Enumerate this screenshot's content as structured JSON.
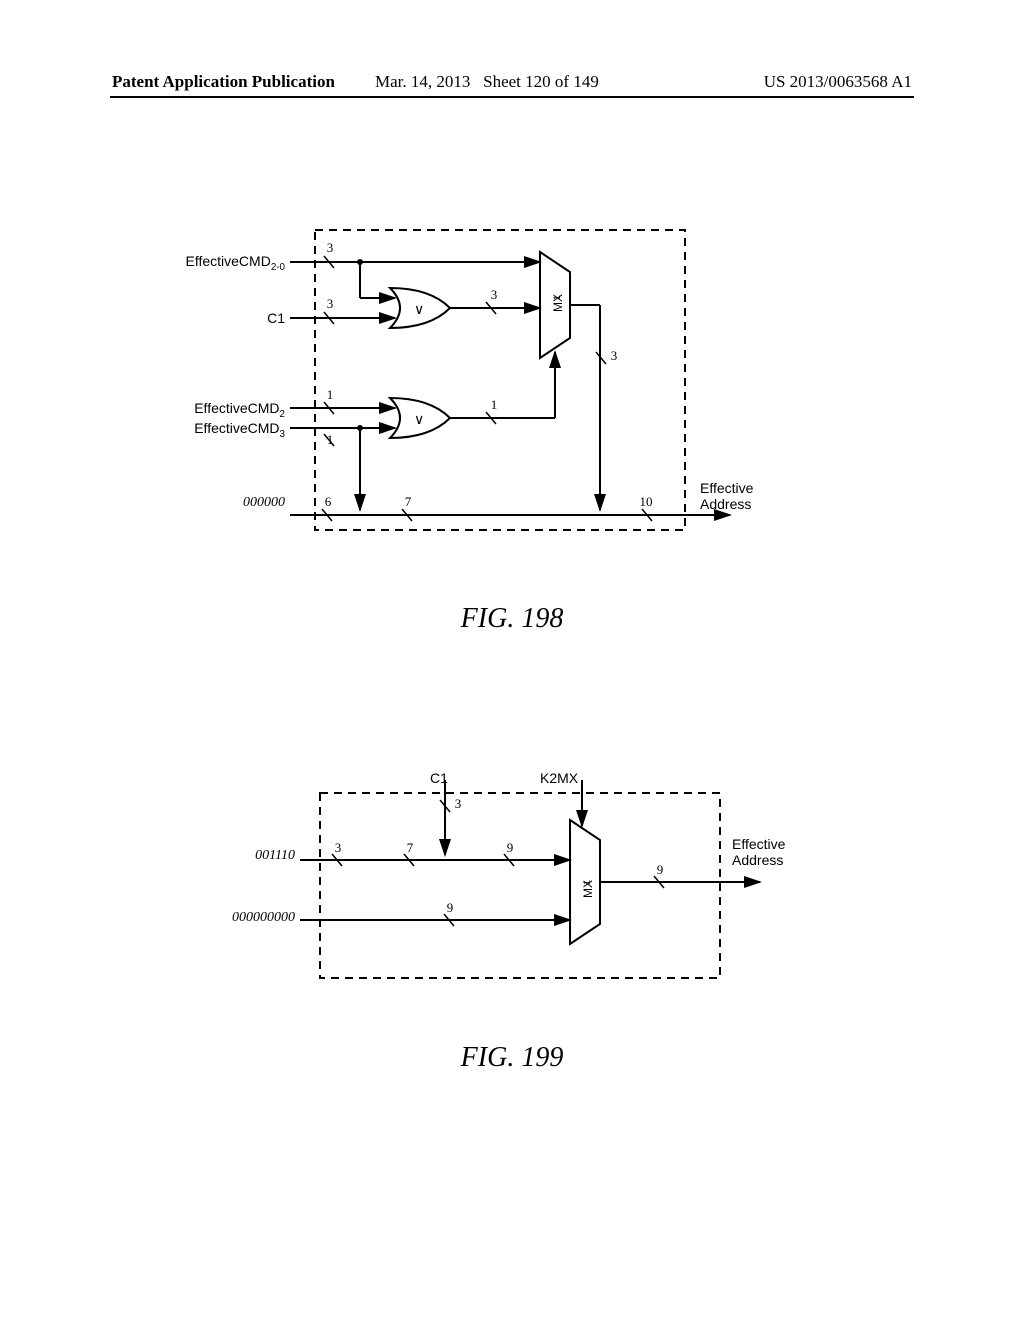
{
  "header": {
    "left": "Patent Application Publication",
    "date": "Mar. 14, 2013",
    "sheet": "Sheet 120 of 149",
    "pubnum": "US 2013/0063568 A1"
  },
  "fig198": {
    "caption": "FIG. 198",
    "inputs": {
      "ecmd20": "EffectiveCMD",
      "ecmd20_sub": "2-0",
      "c1": "C1",
      "ecmd2": "EffectiveCMD",
      "ecmd2_sub": "2",
      "ecmd3": "EffectiveCMD",
      "ecmd3_sub": "3",
      "zeros": "000000"
    },
    "output": {
      "line1": "Effective",
      "line2": "Address"
    },
    "mux": "MX",
    "mux_sub": "1",
    "or": "∨",
    "widths": {
      "w3a": "3",
      "w3b": "3",
      "w3c": "3",
      "w3d": "3",
      "w1a": "1",
      "w1b": "1",
      "w1c": "1",
      "w6": "6",
      "w7": "7",
      "w10": "10"
    }
  },
  "fig199": {
    "caption": "FIG. 199",
    "inputs": {
      "c1": "C1",
      "k2mx": "K2MX",
      "const1": "001110",
      "const2": "000000000"
    },
    "output": {
      "line1": "Effective",
      "line2": "Address"
    },
    "mux": "MX",
    "mux_sub": "1",
    "widths": {
      "w3a": "3",
      "w3b": "3",
      "w7": "7",
      "w9a": "9",
      "w9b": "9",
      "w9c": "9"
    }
  }
}
